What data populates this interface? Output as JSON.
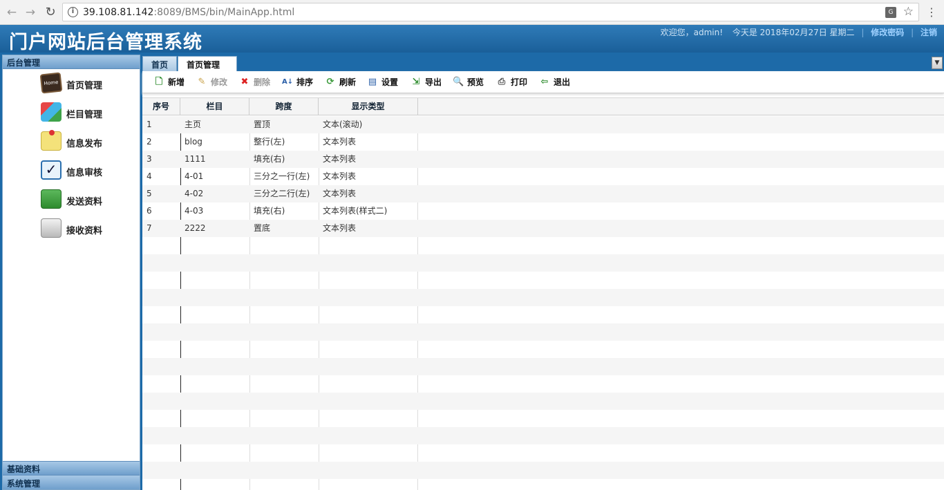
{
  "browser": {
    "url_host": "39.108.81.142",
    "url_rest": ":8089/BMS/bin/MainApp.html",
    "translate_label": "G"
  },
  "header": {
    "title": "门户网站后台管理系统",
    "welcome": "欢迎您，admin!",
    "date": "今天是 2018年02月27日 星期二",
    "change_password": "修改密码",
    "logout": "注销"
  },
  "sidebar": {
    "title": "后台管理",
    "items": [
      {
        "label": "首页管理",
        "icon": "home-board-icon"
      },
      {
        "label": "栏目管理",
        "icon": "blocks-icon"
      },
      {
        "label": "信息发布",
        "icon": "sticky-note-icon"
      },
      {
        "label": "信息审核",
        "icon": "checkbox-icon"
      },
      {
        "label": "发送资料",
        "icon": "printer-icon"
      },
      {
        "label": "接收资料",
        "icon": "bag-icon"
      }
    ],
    "section_basic": "基础资料",
    "section_system": "系统管理"
  },
  "tabs": {
    "home": "首页",
    "active": "首页管理"
  },
  "toolbar": {
    "add": "新增",
    "edit": "修改",
    "delete": "删除",
    "sort": "排序",
    "refresh": "刷新",
    "settings": "设置",
    "export": "导出",
    "preview": "预览",
    "print": "打印",
    "exit": "退出"
  },
  "grid": {
    "columns": [
      "序号",
      "栏目",
      "跨度",
      "显示类型"
    ],
    "rows": [
      [
        "1",
        "主页",
        "置顶",
        "文本(滚动)"
      ],
      [
        "2",
        "blog",
        "整行(左)",
        "文本列表"
      ],
      [
        "3",
        "1111",
        "填充(右)",
        "文本列表"
      ],
      [
        "4",
        "4-01",
        "三分之一行(左)",
        "文本列表"
      ],
      [
        "5",
        "4-02",
        "三分之二行(左)",
        "文本列表"
      ],
      [
        "6",
        "4-03",
        "填充(右)",
        "文本列表(样式二)"
      ],
      [
        "7",
        "2222",
        "置底",
        "文本列表"
      ]
    ]
  },
  "colors": {
    "header_blue": "#1d6aa8",
    "link_blue": "#9fd1ff"
  }
}
